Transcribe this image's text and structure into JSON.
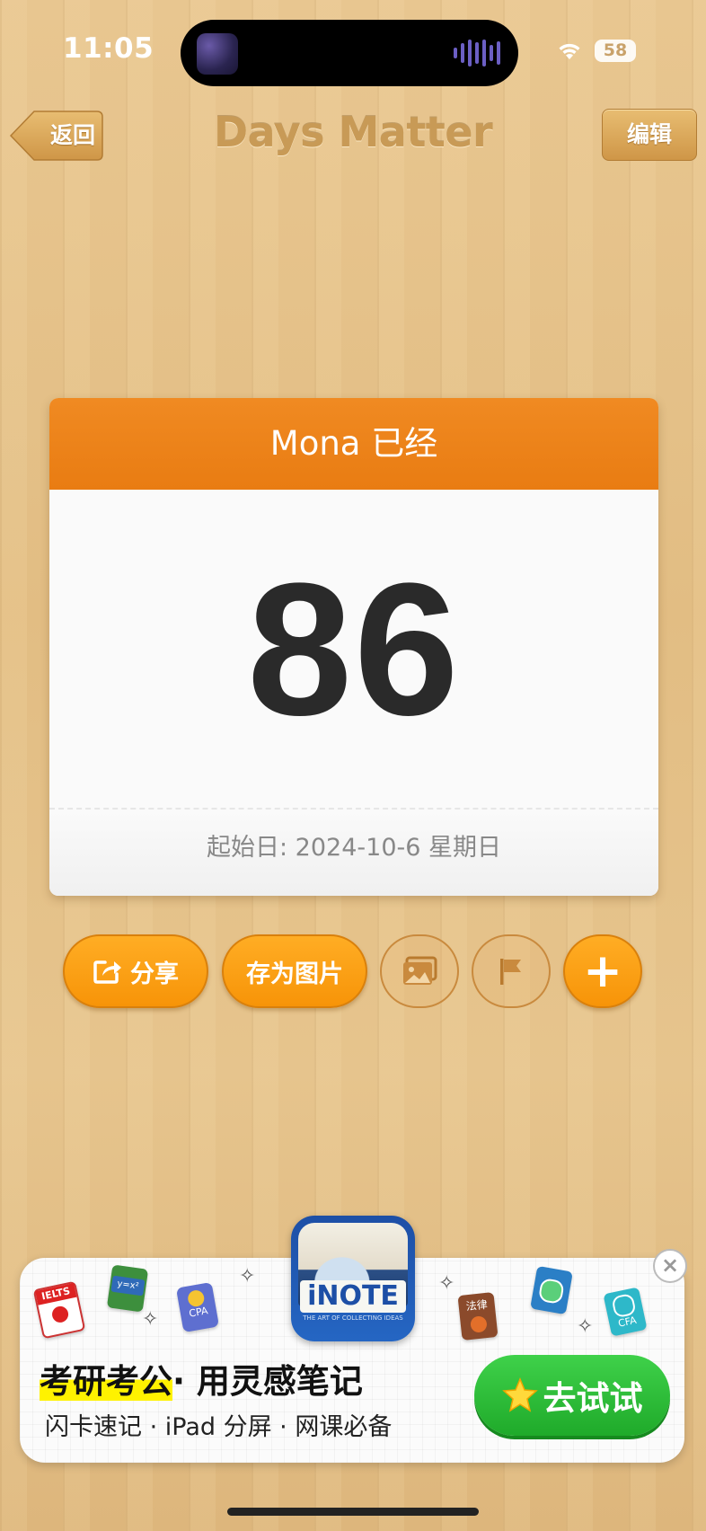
{
  "status_bar": {
    "time": "11:05",
    "battery": "58"
  },
  "nav": {
    "back_label": "返回",
    "title": "Days Matter",
    "edit_label": "编辑"
  },
  "card": {
    "header": "Mona 已经",
    "number": "86",
    "footer": "起始日: 2024-10-6 星期日"
  },
  "actions": {
    "share_label": "分享",
    "save_image_label": "存为图片",
    "add_label": "+"
  },
  "ad": {
    "app_name": "iNOTE",
    "app_tagline": "THE ART OF COLLECTING IDEAS",
    "headline_highlight": "考研考公",
    "headline_rest": "· 用灵感笔记",
    "subline": "闪卡速记 · iPad 分屏 · 网课必备",
    "cta_label": "去试试",
    "close_label": "×",
    "stickers": {
      "ielts": "IELTS",
      "math": "y=x²",
      "cpa": "CPA",
      "law": "法律",
      "cfa": "CFA"
    }
  },
  "colors": {
    "card_header": "#ee8419",
    "button_orange": "#f89a10",
    "cta_green": "#2bbd36",
    "number_text": "#2a2a2a"
  }
}
